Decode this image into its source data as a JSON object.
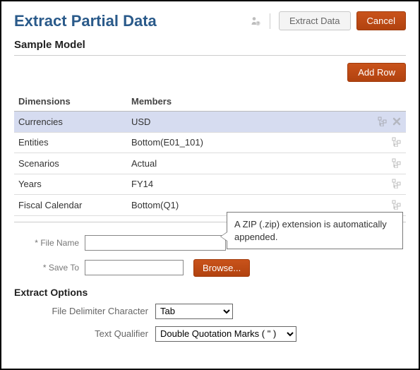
{
  "header": {
    "title": "Extract Partial Data",
    "extract_label": "Extract Data",
    "cancel_label": "Cancel"
  },
  "subtitle": "Sample Model",
  "addrow_label": "Add Row",
  "table": {
    "col_dimensions": "Dimensions",
    "col_members": "Members",
    "rows": [
      {
        "dim": "Currencies",
        "mem": "USD",
        "selected": true,
        "removable": true
      },
      {
        "dim": "Entities",
        "mem": "Bottom(E01_101)",
        "selected": false,
        "removable": false
      },
      {
        "dim": "Scenarios",
        "mem": "Actual",
        "selected": false,
        "removable": false
      },
      {
        "dim": "Years",
        "mem": "FY14",
        "selected": false,
        "removable": false
      },
      {
        "dim": "Fiscal Calendar",
        "mem": "Bottom(Q1)",
        "selected": false,
        "removable": false
      }
    ]
  },
  "tooltip": "A ZIP (.zip) extension is automatically appended.",
  "file": {
    "name_label": "File Name",
    "name_value": "",
    "saveto_label": "Save To",
    "saveto_value": "",
    "browse_label": "Browse..."
  },
  "options": {
    "title": "Extract Options",
    "delimiter_label": "File Delimiter Character",
    "delimiter_value": "Tab",
    "qualifier_label": "Text Qualifier",
    "qualifier_value": "Double Quotation Marks ( \" )"
  }
}
